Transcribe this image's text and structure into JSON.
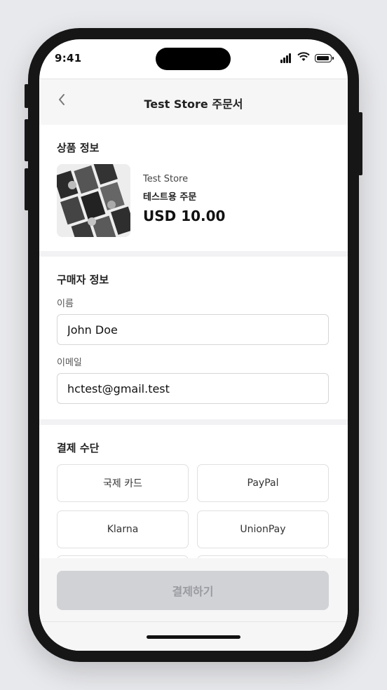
{
  "status": {
    "time": "9:41"
  },
  "header": {
    "title": "Test Store 주문서",
    "back_icon": "chevron-left-icon"
  },
  "product_section": {
    "title": "상품 정보",
    "store": "Test Store",
    "product_name": "테스트용 주문",
    "price": "USD 10.00"
  },
  "buyer_section": {
    "title": "구매자 정보",
    "name_label": "이름",
    "name_value": "John Doe",
    "email_label": "이메일",
    "email_value": "hctest@gmail.test"
  },
  "payment_section": {
    "title": "결제 수단",
    "methods": [
      "국제 카드",
      "PayPal",
      "Klarna",
      "UnionPay"
    ]
  },
  "footer": {
    "submit_label": "결제하기"
  },
  "colors": {
    "submit_disabled_bg": "#d1d2d6",
    "submit_disabled_text": "#9a9ba1"
  }
}
